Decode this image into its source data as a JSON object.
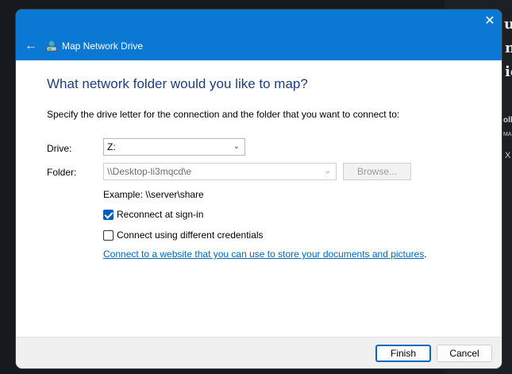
{
  "background": {
    "fragments": [
      "u'v",
      "nc",
      "ie",
      "oll",
      "MA",
      "X"
    ]
  },
  "dialog": {
    "title": "Map Network Drive",
    "close_glyph": "✕",
    "back_glyph": "←",
    "heading": "What network folder would you like to map?",
    "description": "Specify the drive letter for the connection and the folder that you want to connect to:",
    "drive": {
      "label": "Drive:",
      "value": "Z:"
    },
    "folder": {
      "label": "Folder:",
      "value": "\\\\Desktop-li3mqcd\\e",
      "browse_label": "Browse..."
    },
    "example": "Example: \\\\server\\share",
    "reconnect": {
      "label": "Reconnect at sign-in",
      "checked": true
    },
    "different_credentials": {
      "label": "Connect using different credentials",
      "checked": false
    },
    "link": {
      "text": "Connect to a website that you can use to store your documents and pictures",
      "suffix": "."
    },
    "buttons": {
      "finish": "Finish",
      "cancel": "Cancel"
    },
    "accent_color": "#0b78d4"
  }
}
